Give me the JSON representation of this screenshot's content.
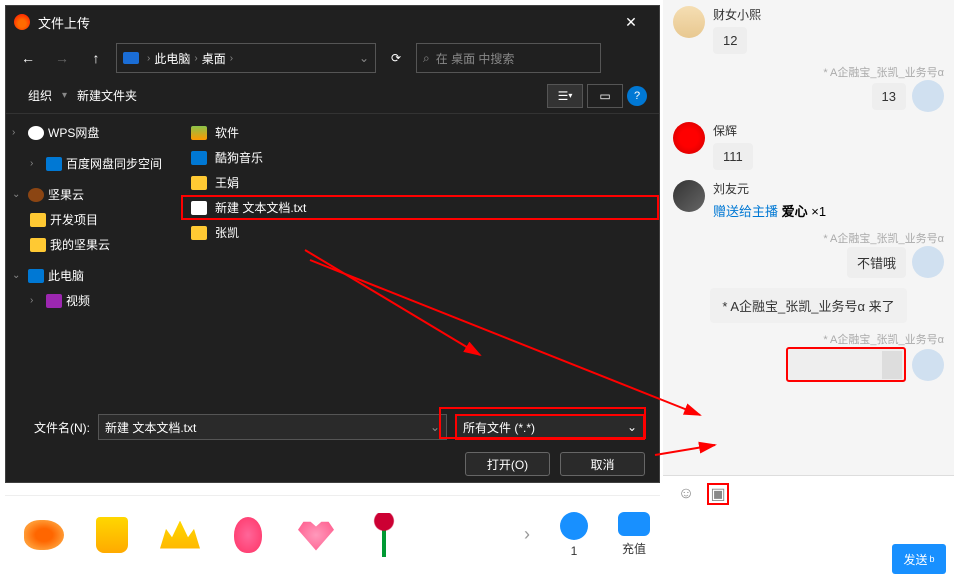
{
  "dialog": {
    "title": "文件上传",
    "path": {
      "root": "此电脑",
      "current": "桌面"
    },
    "search_placeholder": "在 桌面 中搜索",
    "toolbar": {
      "organize": "组织",
      "new_folder": "新建文件夹"
    },
    "sidebar": [
      {
        "label": "WPS网盘",
        "icon": "cloud",
        "expandable": true
      },
      {
        "label": "百度网盘同步空间",
        "icon": "blue",
        "expandable": true,
        "indent": true
      },
      {
        "label": "坚果云",
        "icon": "nut",
        "expandable": true,
        "expanded": true
      },
      {
        "label": "开发项目",
        "icon": "folder",
        "indent": true
      },
      {
        "label": "我的坚果云",
        "icon": "folder",
        "indent": true
      },
      {
        "label": "此电脑",
        "icon": "pc",
        "expandable": true,
        "expanded": true
      },
      {
        "label": "视频",
        "icon": "video",
        "indent": true
      }
    ],
    "files": [
      {
        "name": "软件",
        "icon": "app"
      },
      {
        "name": "酷狗音乐",
        "icon": "blue"
      },
      {
        "name": "王娟",
        "icon": "folder"
      },
      {
        "name": "新建 文本文档.txt",
        "icon": "doc",
        "highlighted": true
      },
      {
        "name": "张凯",
        "icon": "folder"
      }
    ],
    "filename_label": "文件名(N):",
    "filename_value": "新建 文本文档.txt",
    "filter_value": "所有文件 (*.*)",
    "open_btn": "打开(O)",
    "cancel_btn": "取消"
  },
  "chat": {
    "messages": [
      {
        "type": "left",
        "avatar": "av1",
        "name": "财女小熙",
        "text": "12"
      },
      {
        "type": "right",
        "avatar": "av4",
        "name": "* A企融宝_张凯_业务号α",
        "text": "13"
      },
      {
        "type": "left",
        "avatar": "av2",
        "name": "保辉",
        "text": "111"
      },
      {
        "type": "gift",
        "avatar": "av3",
        "name": "刘友元",
        "action": "赠送给主播",
        "gift": "爱心",
        "count": "×1"
      },
      {
        "type": "right",
        "avatar": "av4",
        "name": "* A企融宝_张凯_业务号α",
        "text": "不错哦"
      },
      {
        "type": "system",
        "text": "* A企融宝_张凯_业务号α 来了"
      },
      {
        "type": "right-empty",
        "avatar": "av4",
        "name": "* A企融宝_张凯_业务号α"
      }
    ],
    "send_label": "发送",
    "send_sub": "b"
  },
  "gifts": {
    "items": [
      "fish",
      "trophy",
      "crown",
      "balloon",
      "heart",
      "rose"
    ],
    "stat1_value": "1",
    "stat2_label": "充值"
  }
}
